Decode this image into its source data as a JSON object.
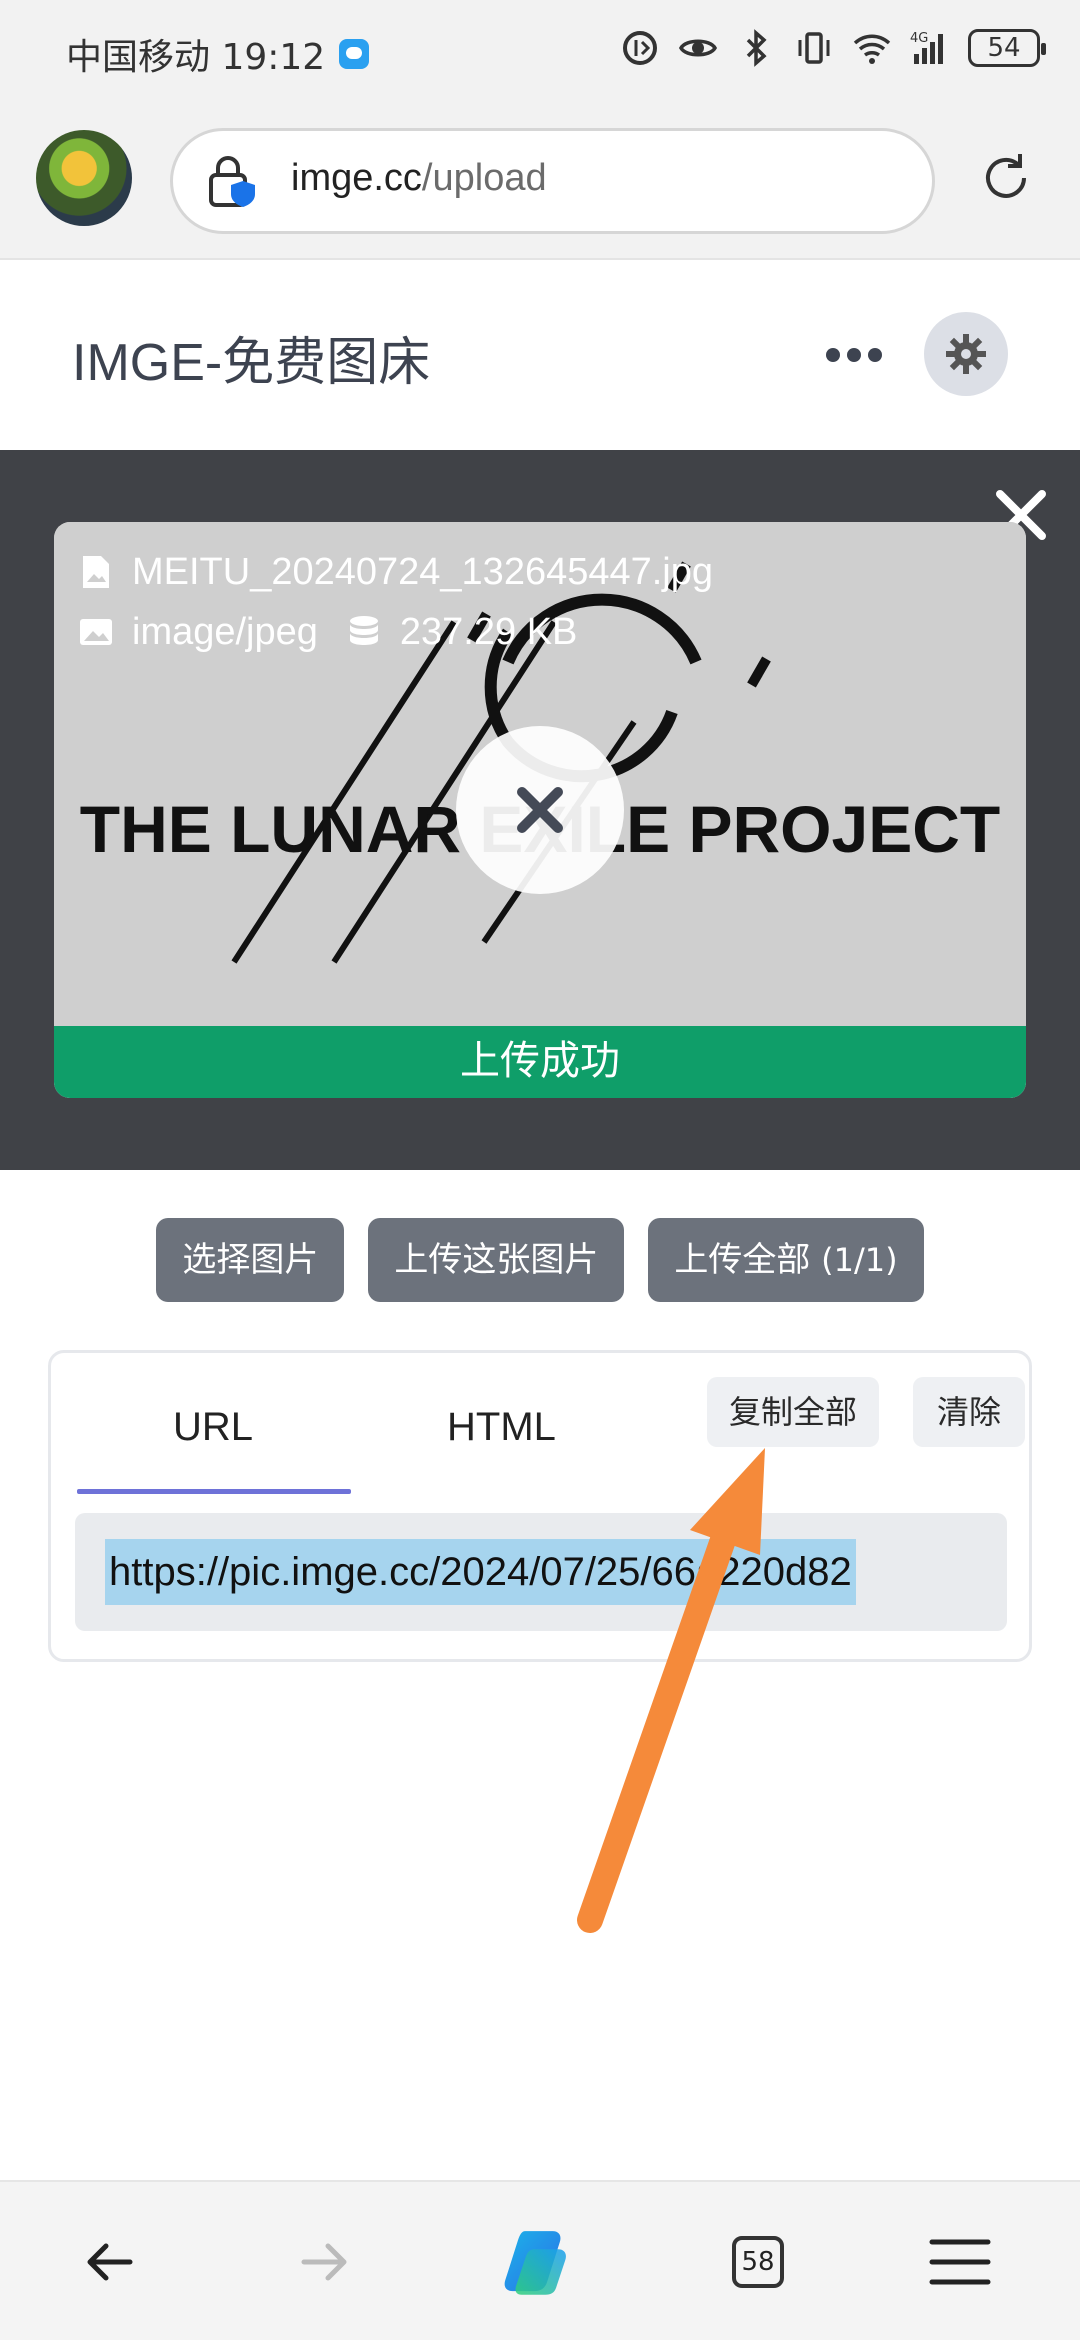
{
  "status_bar": {
    "carrier_time": "中国移动 19:12",
    "battery": "54",
    "network": "4G"
  },
  "browser": {
    "url_domain": "imge.cc",
    "url_path": "/upload",
    "tab_count": "58"
  },
  "site": {
    "title": "IMGE-免费图床"
  },
  "preview": {
    "file_name": "MEITU_20240724_132645447.jpg",
    "mime": "image/jpeg",
    "size": "237.29 KB",
    "image_caption": "THE LUNAR EXILE PROJECT",
    "status": "上传成功"
  },
  "actions": {
    "select": "选择图片",
    "upload_this": "上传这张图片",
    "upload_all": "上传全部",
    "upload_all_count": "(1/1)"
  },
  "results": {
    "tabs": [
      "URL",
      "HTML"
    ],
    "copy_all": "复制全部",
    "clear": "清除",
    "url_value": "https://pic.imge.cc/2024/07/25/66a220d82"
  },
  "colors": {
    "success": "#0f9e69",
    "button": "#6c727c",
    "tab_accent": "#6e72d8",
    "annotation_arrow": "#f58a3a"
  }
}
